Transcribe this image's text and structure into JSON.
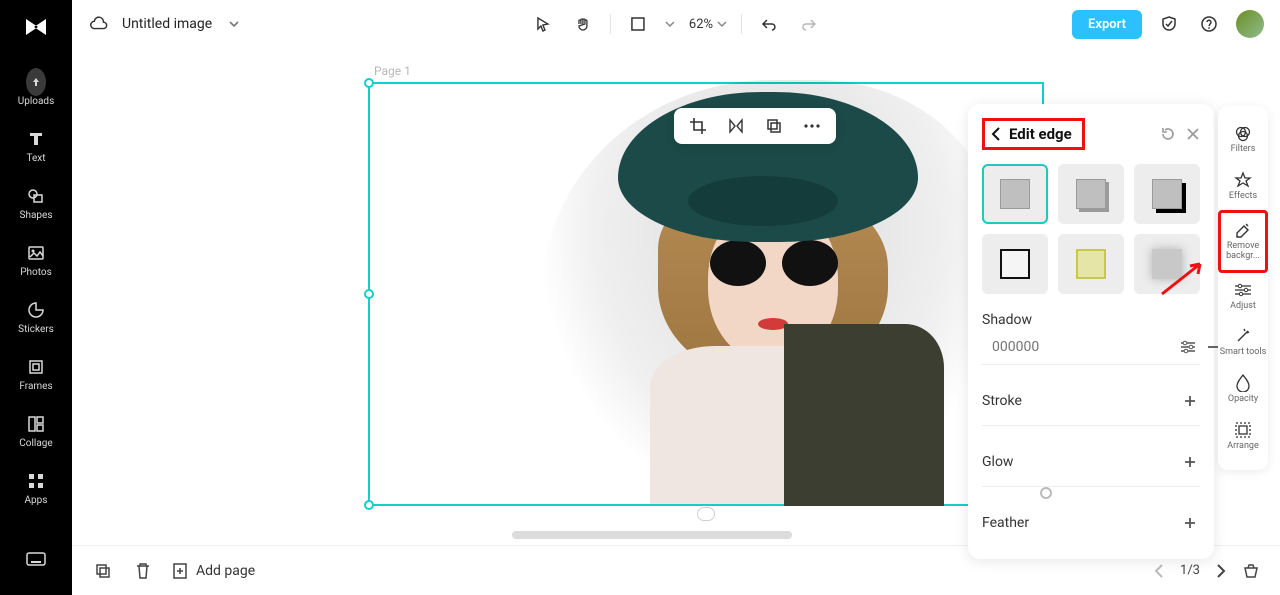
{
  "header": {
    "title_text": "Untitled image",
    "zoom_text": "62%",
    "export_label": "Export"
  },
  "left_nav": {
    "items": [
      {
        "label": "Uploads"
      },
      {
        "label": "Text"
      },
      {
        "label": "Shapes"
      },
      {
        "label": "Photos"
      },
      {
        "label": "Stickers"
      },
      {
        "label": "Frames"
      },
      {
        "label": "Collage"
      },
      {
        "label": "Apps"
      }
    ]
  },
  "canvas": {
    "page_label": "Page 1"
  },
  "context_toolbar": {
    "crop": "crop",
    "flip": "flip",
    "layers": "layers",
    "more": "more"
  },
  "right_panel": {
    "title": "Edit edge",
    "shadow": {
      "label": "Shadow",
      "hex_placeholder": "000000"
    },
    "stroke": {
      "label": "Stroke"
    },
    "glow": {
      "label": "Glow"
    },
    "feather": {
      "label": "Feather"
    }
  },
  "tool_rail": {
    "items": [
      {
        "label": "Filters"
      },
      {
        "label": "Effects"
      },
      {
        "label": "Remove backgr..."
      },
      {
        "label": "Adjust"
      },
      {
        "label": "Smart tools"
      },
      {
        "label": "Opacity"
      },
      {
        "label": "Arrange"
      }
    ]
  },
  "bottom": {
    "add_page": "Add page",
    "page_counter": "1/3"
  }
}
